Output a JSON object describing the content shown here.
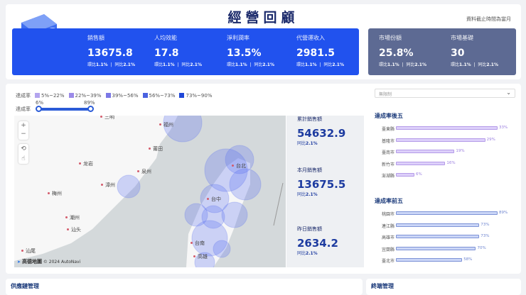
{
  "header": {
    "title": "經營回顧",
    "note": "資料截止時間為當月"
  },
  "kpis_blue": [
    {
      "label": "銷售額",
      "value": "13675.8",
      "mom_label": "環比",
      "mom": "1.1%",
      "yoy_label": "同比",
      "yoy": "2.1%"
    },
    {
      "label": "人均效能",
      "value": "17.8",
      "mom_label": "環比",
      "mom": "1.1%",
      "yoy_label": "同比",
      "yoy": "2.1%"
    },
    {
      "label": "淨利潤率",
      "value": "13.5%",
      "mom_label": "環比",
      "mom": "1.1%",
      "yoy_label": "同比",
      "yoy": "2.1%"
    },
    {
      "label": "代營運收入",
      "value": "2981.5",
      "mom_label": "環比",
      "mom": "1.1%",
      "yoy_label": "同比",
      "yoy": "2.1%"
    }
  ],
  "kpis_gray": [
    {
      "label": "市場份額",
      "value": "25.8%",
      "mom_label": "環比",
      "mom": "1.1%",
      "yoy_label": "同比",
      "yoy": "2.1%"
    },
    {
      "label": "市場基礎",
      "value": "30",
      "mom_label": "環比",
      "mom": "1.1%",
      "yoy_label": "同比",
      "yoy": "2.1%"
    }
  ],
  "legend": {
    "label": "達成率",
    "items": [
      {
        "text": "5%~22%",
        "color": "#b3a4ee"
      },
      {
        "text": "22%~39%",
        "color": "#9b8ae8"
      },
      {
        "text": "39%~56%",
        "color": "#7b78e6"
      },
      {
        "text": "56%~73%",
        "color": "#4a62e0"
      },
      {
        "text": "73%~90%",
        "color": "#1f47d8"
      }
    ]
  },
  "slider": {
    "label": "達成率",
    "min": "6%",
    "max": "89%"
  },
  "map": {
    "zoom_in": "+",
    "zoom_out": "−",
    "attribution_brand": "高德地圖",
    "attribution": "© 2024 AutoNavi",
    "cities": [
      "三明",
      "福州",
      "莆田",
      "龙岩",
      "泉州",
      "漳州",
      "梅州",
      "潮州",
      "汕头",
      "汕尾",
      "台北",
      "台中",
      "台南",
      "高雄"
    ]
  },
  "stats": [
    {
      "label": "累計銷售額",
      "value": "54632.9",
      "cmp_label": "同比",
      "cmp": "2.1%"
    },
    {
      "label": "本月銷售額",
      "value": "13675.5",
      "cmp_label": "同比",
      "cmp": "2.1%"
    },
    {
      "label": "昨日銷售額",
      "value": "2634.2",
      "cmp_label": "同比",
      "cmp": "2.1%"
    }
  ],
  "filter": {
    "value": "無限制"
  },
  "bottom5": {
    "title": "達成率後五",
    "items": [
      {
        "name": "臺東縣",
        "value": 33,
        "label": "33%"
      },
      {
        "name": "基隆市",
        "value": 29,
        "label": "29%"
      },
      {
        "name": "臺南市",
        "value": 19,
        "label": "19%"
      },
      {
        "name": "新竹市",
        "value": 16,
        "label": "16%"
      },
      {
        "name": "澎湖縣",
        "value": 6,
        "label": "6%"
      }
    ]
  },
  "top5": {
    "title": "達成率前五",
    "items": [
      {
        "name": "桃園市",
        "value": 89,
        "label": "89%"
      },
      {
        "name": "連江縣",
        "value": 73,
        "label": "73%"
      },
      {
        "name": "高雄市",
        "value": 73,
        "label": "73%"
      },
      {
        "name": "宜蘭縣",
        "value": 70,
        "label": "70%"
      },
      {
        "name": "臺北市",
        "value": 58,
        "label": "58%"
      }
    ]
  },
  "sections": {
    "supply_chain": "供應鏈管理",
    "terminal": "終端管理"
  }
}
